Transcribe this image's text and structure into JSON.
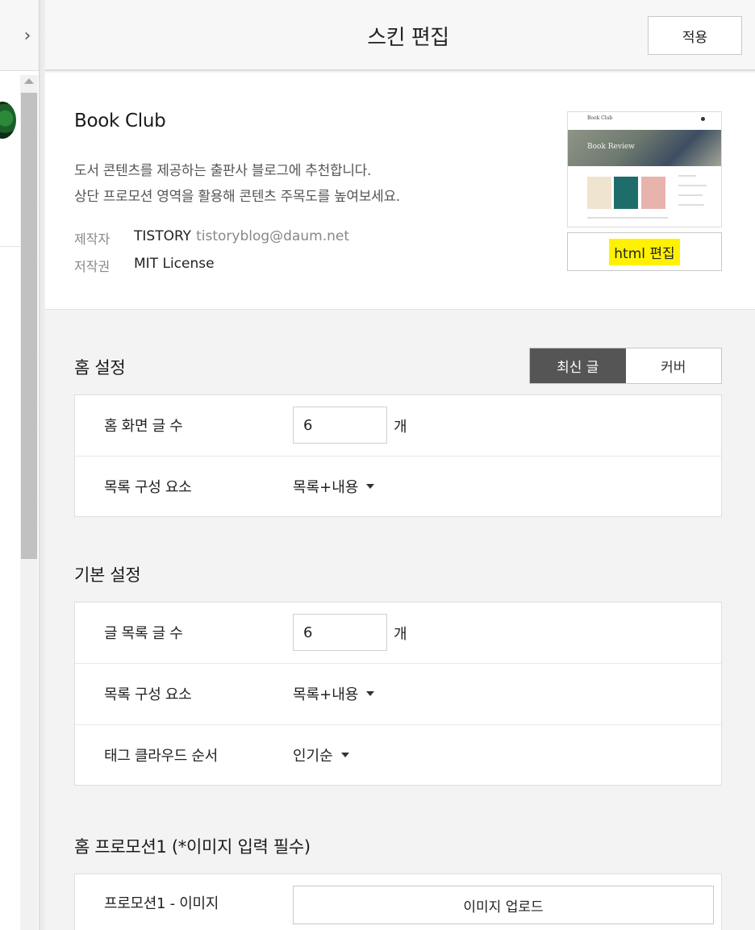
{
  "header": {
    "title": "스킨 편집",
    "apply_label": "적용",
    "collapse_icon": "chevron-right-icon"
  },
  "skin": {
    "name": "Book Club",
    "description_line1": "도서 콘텐츠를 제공하는 출판사 블로그에 추천합니다.",
    "description_line2": "상단 프로모션 영역을 활용해 콘텐츠 주목도를 높여보세요.",
    "author_label": "제작자",
    "author_name": "TISTORY",
    "author_email": "tistoryblog@daum.net",
    "license_label": "저작권",
    "license_value": "MIT License",
    "preview": {
      "logo_text": "Book Club",
      "hero_text": "Book Review"
    },
    "html_edit_label": "html 편집",
    "highlight_color": "#fff200"
  },
  "home_settings": {
    "title": "홈 설정",
    "toggle_latest": "최신 글",
    "toggle_cover": "커버",
    "active_toggle": "최신 글",
    "post_count_label": "홈 화면 글 수",
    "post_count_value": "6",
    "post_count_unit": "개",
    "list_component_label": "목록 구성 요소",
    "list_component_value": "목록+내용"
  },
  "basic_settings": {
    "title": "기본 설정",
    "post_count_label": "글 목록 글 수",
    "post_count_value": "6",
    "post_count_unit": "개",
    "list_component_label": "목록 구성 요소",
    "list_component_value": "목록+내용",
    "tag_order_label": "태그 클라우드 순서",
    "tag_order_value": "인기순"
  },
  "promotion": {
    "title": "홈 프로모션1 (*이미지 입력 필수)",
    "image_label": "프로모션1 - 이미지",
    "upload_label": "이미지 업로드"
  },
  "colors": {
    "toggle_active_bg": "#555555",
    "panel_bg": "#f3f3f4"
  }
}
